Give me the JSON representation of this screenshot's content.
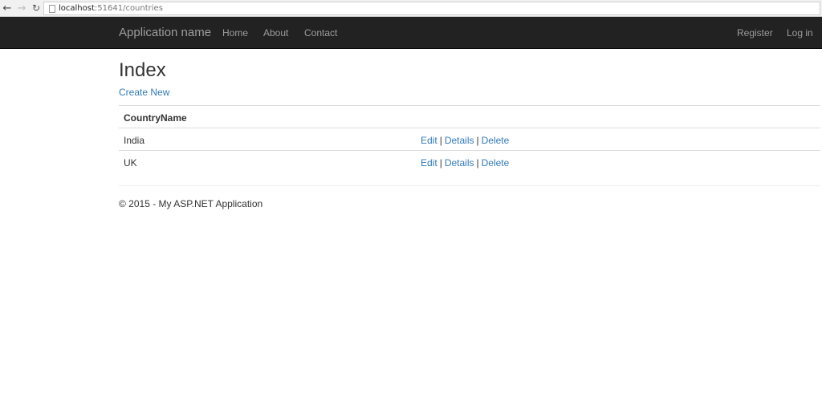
{
  "browser": {
    "url_host": "localhost",
    "url_rest": ":51641/countries"
  },
  "navbar": {
    "brand": "Application name",
    "links": [
      "Home",
      "About",
      "Contact"
    ],
    "right_links": [
      "Register",
      "Log in"
    ]
  },
  "main": {
    "title": "Index",
    "create_link": "Create New",
    "table": {
      "header": "CountryName",
      "rows": [
        {
          "name": "India"
        },
        {
          "name": "UK"
        }
      ],
      "actions": {
        "edit": "Edit",
        "details": "Details",
        "delete": "Delete",
        "separator": "|"
      }
    }
  },
  "footer": {
    "text": "© 2015 - My ASP.NET Application"
  },
  "colors": {
    "navbar_bg": "#222222",
    "link": "#337ab7",
    "nav_text": "#9d9d9d"
  },
  "icons": [
    "back-arrow-icon",
    "forward-arrow-icon",
    "reload-icon",
    "page-icon"
  ]
}
